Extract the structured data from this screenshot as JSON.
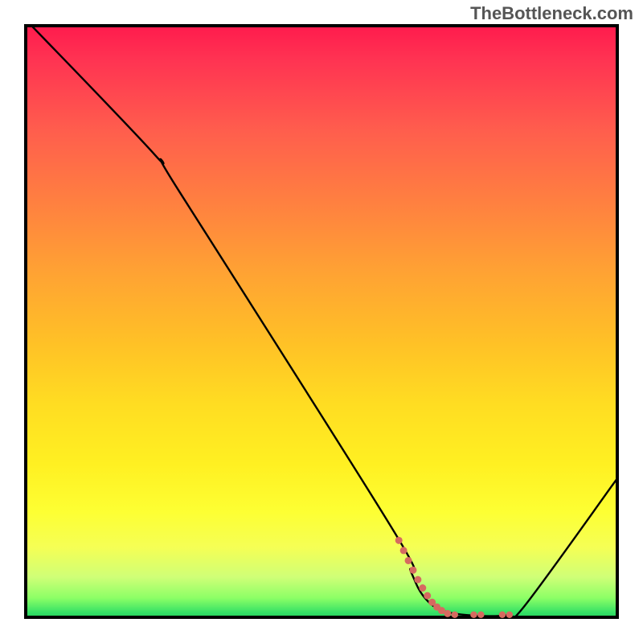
{
  "watermark": "TheBottleneck.com",
  "chart_data": {
    "type": "line",
    "title": "",
    "xlabel": "",
    "ylabel": "",
    "xlim": [
      0,
      100
    ],
    "ylim": [
      0,
      100
    ],
    "gradient_stops": [
      {
        "pct": 0,
        "color": "#ff1a4d"
      },
      {
        "pct": 6,
        "color": "#ff3352"
      },
      {
        "pct": 18,
        "color": "#ff5e4d"
      },
      {
        "pct": 30,
        "color": "#ff8040"
      },
      {
        "pct": 42,
        "color": "#ffa333"
      },
      {
        "pct": 54,
        "color": "#ffc226"
      },
      {
        "pct": 64,
        "color": "#ffdd22"
      },
      {
        "pct": 74,
        "color": "#fff022"
      },
      {
        "pct": 82,
        "color": "#fdff33"
      },
      {
        "pct": 88,
        "color": "#f5ff55"
      },
      {
        "pct": 93,
        "color": "#cfff77"
      },
      {
        "pct": 96.5,
        "color": "#8cff66"
      },
      {
        "pct": 99,
        "color": "#33e066"
      },
      {
        "pct": 100,
        "color": "#22cc55"
      }
    ],
    "series": [
      {
        "name": "bottleneck-curve",
        "color": "#000000",
        "points": [
          {
            "x": 1,
            "y": 100
          },
          {
            "x": 22,
            "y": 78
          },
          {
            "x": 26,
            "y": 72
          },
          {
            "x": 62,
            "y": 15
          },
          {
            "x": 65,
            "y": 8
          },
          {
            "x": 67,
            "y": 4
          },
          {
            "x": 70,
            "y": 1.5
          },
          {
            "x": 75,
            "y": 0.6
          },
          {
            "x": 81,
            "y": 0.6
          },
          {
            "x": 84,
            "y": 2
          },
          {
            "x": 100,
            "y": 24
          }
        ]
      }
    ],
    "highlight_dots": {
      "color": "#d66a60",
      "points": [
        {
          "x": 63.0,
          "y": 13.2,
          "r": 4.5
        },
        {
          "x": 63.8,
          "y": 11.5,
          "r": 4.5
        },
        {
          "x": 64.6,
          "y": 9.8,
          "r": 4.5
        },
        {
          "x": 65.4,
          "y": 8.2,
          "r": 4.5
        },
        {
          "x": 66.2,
          "y": 6.6,
          "r": 4.5
        },
        {
          "x": 67.0,
          "y": 5.2,
          "r": 4.5
        },
        {
          "x": 67.8,
          "y": 3.9,
          "r": 4.5
        },
        {
          "x": 68.6,
          "y": 2.8,
          "r": 4.5
        },
        {
          "x": 69.4,
          "y": 2.0,
          "r": 4.5
        },
        {
          "x": 70.2,
          "y": 1.4,
          "r": 4.5
        },
        {
          "x": 71.2,
          "y": 0.9,
          "r": 4.5
        },
        {
          "x": 72.4,
          "y": 0.7,
          "r": 4.2
        },
        {
          "x": 75.6,
          "y": 0.7,
          "r": 4.2
        },
        {
          "x": 76.8,
          "y": 0.7,
          "r": 4.2
        },
        {
          "x": 80.4,
          "y": 0.7,
          "r": 4.2
        },
        {
          "x": 81.6,
          "y": 0.7,
          "r": 4.2
        }
      ]
    }
  }
}
